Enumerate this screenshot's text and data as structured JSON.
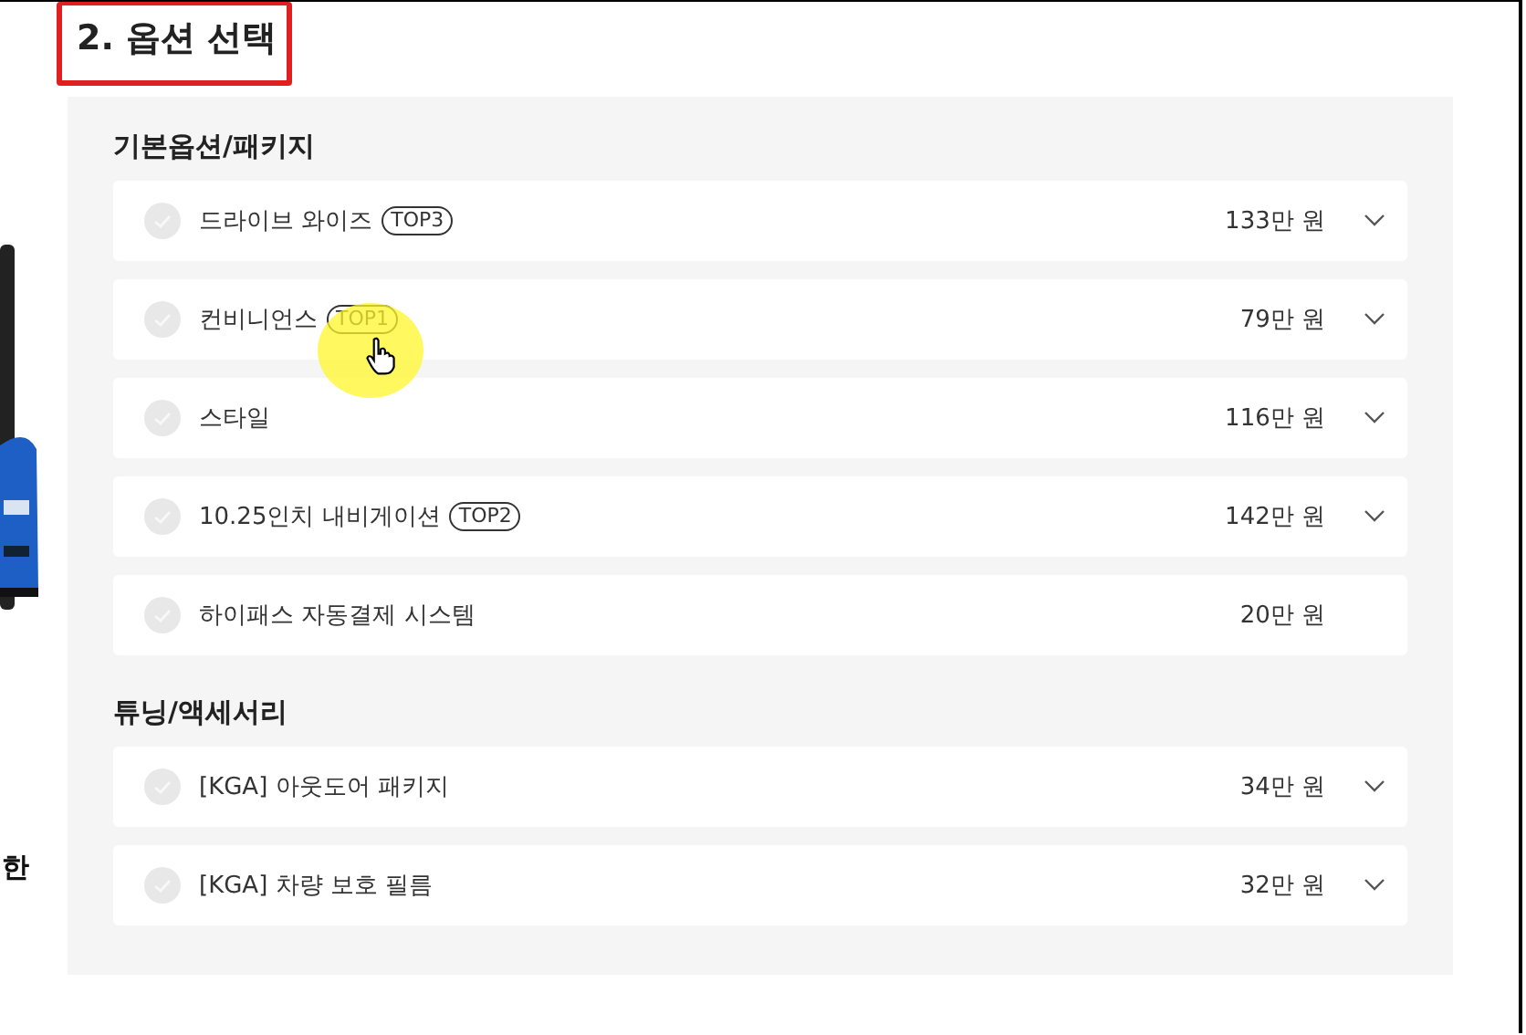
{
  "side_text": "한",
  "title": "2. 옵션 선택",
  "sections": [
    {
      "heading": "기본옵션/패키지",
      "options": [
        {
          "name": "드라이브 와이즈",
          "badge": "TOP3",
          "price": "133만 원",
          "checked": false,
          "expandable": true
        },
        {
          "name": "컨비니언스",
          "badge": "TOP1",
          "price": "79만 원",
          "checked": false,
          "expandable": true
        },
        {
          "name": "스타일",
          "price": "116만 원",
          "checked": false,
          "expandable": true
        },
        {
          "name": "10.25인치 내비게이션",
          "badge": "TOP2",
          "price": "142만 원",
          "checked": false,
          "expandable": true
        },
        {
          "name": "하이패스 자동결제 시스템",
          "price": "20만 원",
          "checked": false,
          "expandable": false
        }
      ]
    },
    {
      "heading": "튜닝/액세서리",
      "options": [
        {
          "name": "[KGA] 아웃도어 패키지",
          "price": "34만 원",
          "checked": false,
          "expandable": true
        },
        {
          "name": "[KGA] 차량 보호 필름",
          "price": "32만 원",
          "checked": false,
          "expandable": true
        }
      ]
    }
  ]
}
